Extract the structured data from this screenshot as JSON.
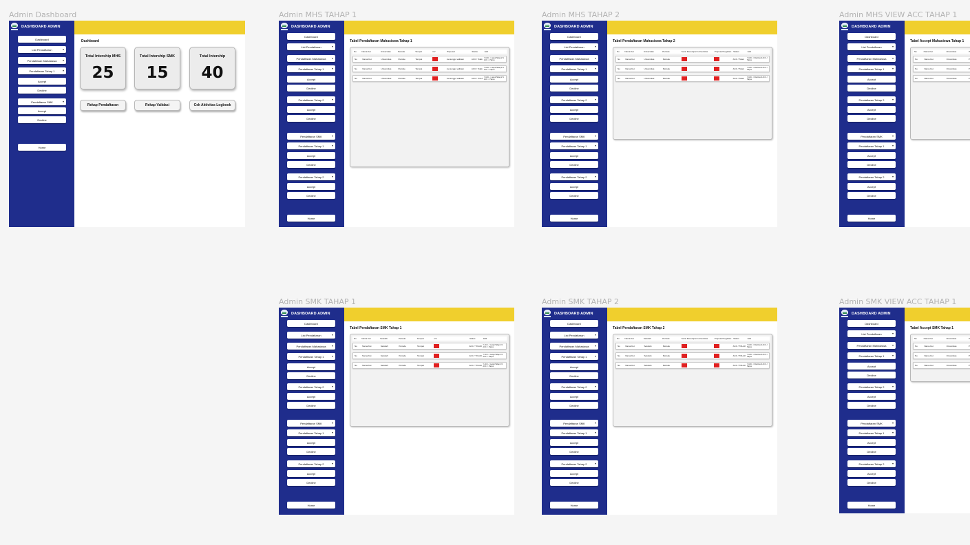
{
  "brand": {
    "title": "DASHBOARD ADMIN",
    "logo_icon": "globe-logo"
  },
  "colors": {
    "sidebar": "#1f2d8c",
    "topbar": "#f0cf2d",
    "status_red": "#e02020"
  },
  "frames": {
    "dashboard": {
      "label": "Admin Dashboard",
      "page_title": "Dashboard",
      "nav": {
        "dashboard": "Dashboard",
        "list_pendaftaran": "List Pendaftaran",
        "pendaftaran_mahasiswa": "Pendaftaran Mahasiswa",
        "pendaftaran_tahap_1": "Pendaftaran Tahap 1",
        "accept": "Accept",
        "decline": "Decline",
        "pendaftaran_smk": "Pendaftaran SMK",
        "accept_2": "Accept",
        "decline_2": "Decline",
        "home": "Home"
      },
      "stats": [
        {
          "label": "Total Intership MHS",
          "value": "25"
        },
        {
          "label": "Total Intership SMK",
          "value": "15"
        },
        {
          "label": "Total Intership",
          "value": "40"
        }
      ],
      "actions": [
        "Rekap Pendaftaran",
        "Rekap Validasi",
        "Cek Aktivitas Logbook"
      ]
    },
    "mhs1": {
      "label": "Admin MHS TAHAP 1",
      "table_title": "Tabel Pendaftaran Mahasiswa Tahap 1",
      "headers": [
        "No",
        "Nama Ket",
        "Universitas",
        "Periode",
        "Tempat",
        "CV",
        "Proposal",
        "Status",
        "Edit"
      ],
      "rows": [
        [
          "No",
          "Nama Ket",
          "Universitas",
          "Periode",
          "Tempat",
          "",
          "menunggu validasi",
          "ACC / Tolak",
          "Y ACC -> Lanjut Tahap 2  N ACC -> Hapus"
        ],
        [
          "No",
          "Nama Ket",
          "Universitas",
          "Periode",
          "Tempat",
          "",
          "menunggu validasi",
          "ACC / Tolak",
          "Y ACC -> Lanjut Tahap 2  N ACC -> Hapus"
        ],
        [
          "No",
          "Nama Ket",
          "Universitas",
          "Periode",
          "Tempat",
          "",
          "menunggu validasi",
          "ACC / TOLAK",
          "Y ACC -> Lanjut Tahap 2  N ACC -> Hapus"
        ]
      ]
    },
    "mhs2": {
      "label": "Admin MHS TAHAP 2",
      "table_title": "Tabel Pendaftaran Mahasiswa Tahap 2",
      "headers": [
        "No",
        "Nama Ket",
        "Universitas",
        "Periode",
        "Surat Penerapan Universitas",
        "Proposal Kegiatan",
        "Status",
        "Edit"
      ],
      "rows": [
        [
          "No",
          "Nama Ket",
          "Universitas",
          "Periode",
          "",
          "",
          "ACC / Tolak",
          "Y ACC -> Diterima  N ACC -> Hapus"
        ],
        [
          "No",
          "Nama Ket",
          "Universitas",
          "Periode",
          "",
          "",
          "ACC / Tolak",
          "Y ACC -> Diterima  N ACC -> Hapus"
        ],
        [
          "No",
          "Nama Ket",
          "Universitas",
          "Periode",
          "",
          "",
          "ACC / Tolak",
          "Y ACC -> Diterima  N ACC -> Hapus"
        ]
      ]
    },
    "mhs_acc": {
      "label": "Admin MHS VIEW ACC TAHAP 1",
      "table_title": "Tabel Accept Mahasiswa Tahap 1",
      "headers": [
        "No",
        "Nama Ket",
        "Universitas",
        "Periode"
      ],
      "rows": [
        [
          "No",
          "Nama Ket",
          "Universitas",
          "Periode"
        ],
        [
          "No",
          "Nama Ket",
          "Universitas",
          "Periode"
        ],
        [
          "No",
          "Nama Ket",
          "Universitas",
          "Periode"
        ]
      ]
    },
    "smk1": {
      "label": "Admin SMK TAHAP 1",
      "table_title": "Tabel Pendaftaran SMK Tahap 1",
      "headers": [
        "No",
        "Nama Ket",
        "Sekolah",
        "Periode",
        "Tempat",
        "CV",
        "Status",
        "Edit"
      ],
      "rows": [
        [
          "No",
          "Nama Ket",
          "Sekolah",
          "Periode",
          "Tempat",
          "",
          "ACC / TOLAK",
          "Y ACC -> Lanjut Tahap 2  N ACC -> Hapus"
        ],
        [
          "No",
          "Nama Ket",
          "Sekolah",
          "Periode",
          "Tempat",
          "",
          "ACC / TOLAK",
          "Y ACC -> Lanjut Tahap 2  N ACC -> Hapus"
        ],
        [
          "No",
          "Nama Ket",
          "Sekolah",
          "Periode",
          "Tempat",
          "",
          "ACC / TOLAK",
          "Y ACC -> Lanjut Tahap 2  N ACC -> Hapus"
        ]
      ]
    },
    "smk2": {
      "label": "Admin SMK TAHAP 2",
      "table_title": "Tabel Pendaftaran SMK Tahap 2",
      "headers": [
        "No",
        "Nama Ket",
        "Sekolah",
        "Periode",
        "Surat Penerapan Universitas",
        "Proposal Kegiatan",
        "Status",
        "Edit"
      ],
      "rows": [
        [
          "No",
          "Nama Ket",
          "Sekolah",
          "Periode",
          "",
          "",
          "ACC / TOLAK",
          "Y ACC -> Diterima  N ACC -> Hapus"
        ],
        [
          "No",
          "Nama Ket",
          "Sekolah",
          "Periode",
          "",
          "",
          "ACC / TOLAK",
          "Y ACC -> Diterima  N ACC -> Hapus"
        ],
        [
          "No",
          "Nama Ket",
          "Sekolah",
          "Periode",
          "",
          "",
          "ACC / TOLAK",
          "Y ACC -> Diterima  N ACC -> Hapus"
        ]
      ]
    },
    "smk_acc": {
      "label": "Admin SMK VIEW ACC TAHAP 1",
      "table_title": "Tabel Accept SMK Tahap 1",
      "headers": [
        "No",
        "Nama Ket",
        "Universitas",
        "Periode"
      ],
      "rows": [
        [
          "No",
          "Nama Ket",
          "Universitas",
          "Periode"
        ],
        [
          "No",
          "Nama Ket",
          "Universitas",
          "Periode"
        ],
        [
          "No",
          "Nama Ket",
          "Universitas",
          "Periode"
        ]
      ]
    }
  },
  "long_nav": [
    {
      "key": "dashboard",
      "label": "Dashboard",
      "caret": false
    },
    {
      "key": "list-pendaftaran",
      "label": "List Pendaftaran",
      "caret": true
    },
    {
      "key": "pendaftaran-mahasiswa",
      "label": "Pendaftaran Mahasiswa",
      "caret": true
    },
    {
      "key": "pendaftaran-tahap-1",
      "label": "Pendaftaran Tahap 1",
      "caret": true
    },
    {
      "key": "accept",
      "label": "Accept",
      "caret": false
    },
    {
      "key": "decline",
      "label": "Decline",
      "caret": false
    },
    {
      "key": "pendaftaran-tahap-2",
      "label": "Pendaftaran Tahap 2",
      "caret": true
    },
    {
      "key": "accept-2",
      "label": "Accept",
      "caret": false
    },
    {
      "key": "decline-2",
      "label": "Decline",
      "caret": false
    },
    {
      "key": "pendaftaran-smk",
      "label": "Pendaftaran SMK",
      "caret": true
    },
    {
      "key": "smk-tahap-1",
      "label": "Pendaftaran Tahap 1",
      "caret": true
    },
    {
      "key": "accept-3",
      "label": "Accept",
      "caret": false
    },
    {
      "key": "decline-3",
      "label": "Decline",
      "caret": false
    },
    {
      "key": "smk-tahap-2",
      "label": "Pendaftaran Tahap 2",
      "caret": true
    },
    {
      "key": "accept-4",
      "label": "Accept",
      "caret": false
    },
    {
      "key": "decline-4",
      "label": "Decline",
      "caret": false
    },
    {
      "key": "home",
      "label": "Home",
      "caret": false
    }
  ]
}
